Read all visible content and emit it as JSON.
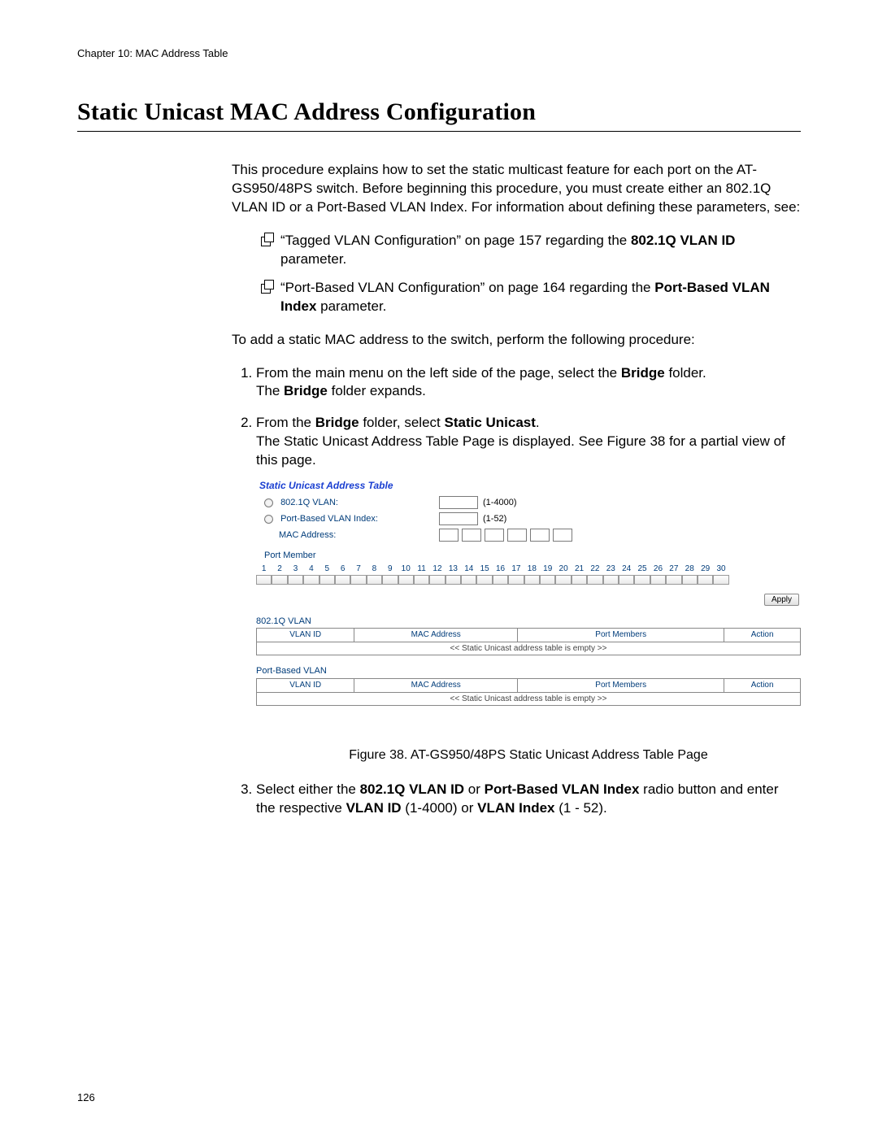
{
  "header": {
    "chapter": "Chapter 10: MAC Address Table"
  },
  "title": "Static Unicast MAC Address Configuration",
  "intro": "This procedure explains how to set the static multicast feature for each port on the AT-GS950/48PS switch. Before beginning this procedure, you must create either an 802.1Q VLAN ID or a Port-Based VLAN Index. For information about defining these parameters, see:",
  "bullets": {
    "b1_a": "“Tagged VLAN Configuration” on page 157 regarding the ",
    "b1_b": "802.1Q VLAN ID",
    "b1_c": " parameter.",
    "b2_a": "“Port-Based VLAN Configuration” on page 164 regarding the ",
    "b2_b": "Port-Based VLAN Index",
    "b2_c": " parameter."
  },
  "lead2": "To add a static MAC address to the switch, perform the following procedure:",
  "steps": {
    "s1_a": "From the main menu on the left side of the page, select the ",
    "s1_b": "Bridge",
    "s1_c": " folder.",
    "s1_d": "The ",
    "s1_e": "Bridge",
    "s1_f": " folder expands.",
    "s2_a": "From the ",
    "s2_b": "Bridge",
    "s2_c": " folder, select ",
    "s2_d": "Static Unicast",
    "s2_e": ".",
    "s2_f": "The Static Unicast Address Table Page is displayed. See Figure 38 for a partial view of this page.",
    "s3_a": "Select either the ",
    "s3_b": "802.1Q VLAN ID",
    "s3_c": " or ",
    "s3_d": "Port-Based VLAN Index",
    "s3_e": " radio button and enter the respective ",
    "s3_f": "VLAN ID",
    "s3_g": " (1-4000) or ",
    "s3_h": "VLAN Index",
    "s3_i": " (1 - 52)."
  },
  "ui": {
    "title": "Static Unicast Address Table",
    "vlan8021q_label": "802.1Q VLAN:",
    "vlan8021q_range": "(1-4000)",
    "portbased_label": "Port-Based VLAN Index:",
    "portbased_range": "(1-52)",
    "mac_label": "MAC Address:",
    "portmember_label": "Port Member",
    "apply": "Apply",
    "sec1_title": "802.1Q VLAN",
    "sec2_title": "Port-Based VLAN",
    "th_vlanid": "VLAN ID",
    "th_mac": "MAC Address",
    "th_members": "Port Members",
    "th_action": "Action",
    "empty_row": "<< Static Unicast address table is empty >>",
    "ports": [
      "1",
      "2",
      "3",
      "4",
      "5",
      "6",
      "7",
      "8",
      "9",
      "10",
      "11",
      "12",
      "13",
      "14",
      "15",
      "16",
      "17",
      "18",
      "19",
      "20",
      "21",
      "22",
      "23",
      "24",
      "25",
      "26",
      "27",
      "28",
      "29",
      "30"
    ]
  },
  "figure_caption": "Figure 38. AT-GS950/48PS Static Unicast Address Table Page",
  "page_number": "126"
}
